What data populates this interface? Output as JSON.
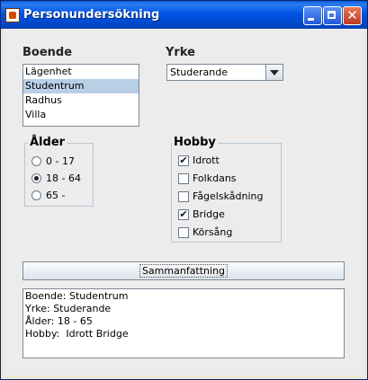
{
  "window": {
    "title": "Personundersökning"
  },
  "boende": {
    "label": "Boende",
    "items": [
      "Lägenhet",
      "Studentrum",
      "Radhus",
      "Villa"
    ],
    "selected": "Studentrum"
  },
  "yrke": {
    "label": "Yrke",
    "selected": "Studerande"
  },
  "alder": {
    "label": "Ålder",
    "options": [
      "0 - 17",
      "18 - 64",
      "65 -"
    ],
    "selected": "18 - 64"
  },
  "hobby": {
    "label": "Hobby",
    "options": [
      "Idrott",
      "Folkdans",
      "Fågelskådning",
      "Bridge",
      "Körsång"
    ],
    "checked": [
      true,
      false,
      false,
      true,
      false
    ]
  },
  "summary_button": "Sammanfattning",
  "summary": [
    "Boende: Studentrum",
    "Yrke: Studerande",
    "Ålder: 18 - 65",
    "Hobby:  Idrott Bridge"
  ]
}
